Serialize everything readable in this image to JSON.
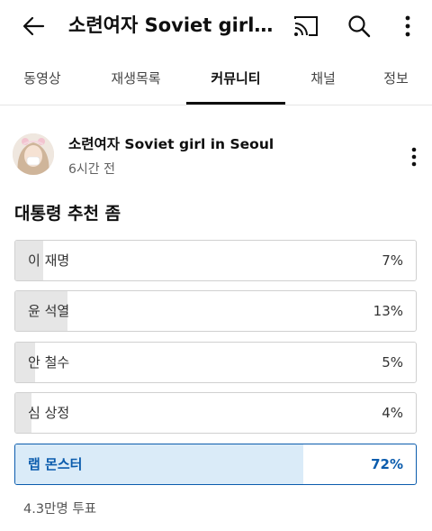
{
  "header": {
    "title": "소련여자 Soviet girl in Seoul"
  },
  "tabs": [
    "동영상",
    "재생목록",
    "커뮤니티",
    "채널",
    "정보"
  ],
  "post": {
    "author": "소련여자 Soviet girl in Seoul",
    "time": "6시간 전",
    "question": "대통령 추천 좀",
    "options": [
      {
        "label": "이 재명",
        "percent_text": "7%",
        "percent": 7,
        "selected": false
      },
      {
        "label": "윤 석열",
        "percent_text": "13%",
        "percent": 13,
        "selected": false
      },
      {
        "label": "안 철수",
        "percent_text": "5%",
        "percent": 5,
        "selected": false
      },
      {
        "label": "심 상정",
        "percent_text": "4%",
        "percent": 4,
        "selected": false
      },
      {
        "label": "랩 몬스터",
        "percent_text": "72%",
        "percent": 72,
        "selected": true
      }
    ],
    "votes": "4.3만명 투표"
  },
  "colors": {
    "accent": "#0b5cad",
    "selected_fill": "#daebf8",
    "bar_fill": "#e6e6e6"
  },
  "icons": [
    "back-arrow-icon",
    "cast-icon",
    "search-icon",
    "more-vert-icon"
  ]
}
